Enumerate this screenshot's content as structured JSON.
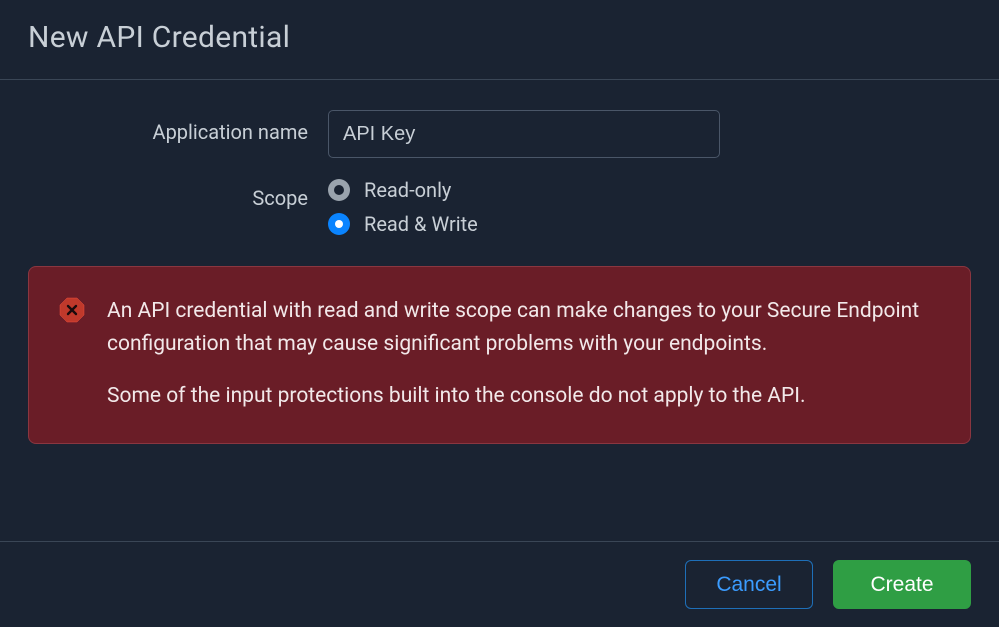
{
  "header": {
    "title": "New API Credential"
  },
  "form": {
    "app_name_label": "Application name",
    "app_name_value": "API Key",
    "scope_label": "Scope",
    "scope_options": {
      "read_only": "Read-only",
      "read_write": "Read & Write"
    },
    "scope_selected": "read_write"
  },
  "alert": {
    "icon": "error-icon",
    "paragraph1": "An API credential with read and write scope can make changes to your Secure Endpoint configuration that may cause significant problems with your endpoints.",
    "paragraph2": "Some of the input protections built into the console do not apply to the API."
  },
  "footer": {
    "cancel_label": "Cancel",
    "create_label": "Create"
  },
  "colors": {
    "background": "#1a2332",
    "alert_bg": "#6a1d27",
    "accent_blue": "#0a84ff",
    "create_green": "#2f9e44"
  }
}
